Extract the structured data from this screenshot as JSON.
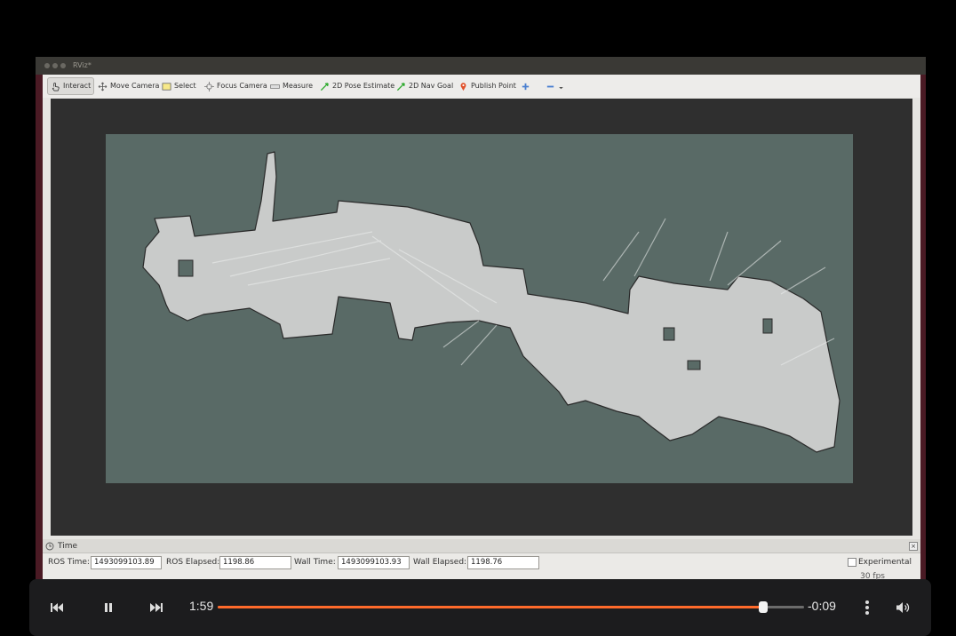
{
  "window": {
    "title": "RViz*"
  },
  "toolbar": {
    "tools": [
      {
        "label": "Interact",
        "icon": "hand-pointer-icon"
      },
      {
        "label": "Move Camera",
        "icon": "move-arrows-icon"
      },
      {
        "label": "Select",
        "icon": "select-box-icon"
      },
      {
        "label": "Focus Camera",
        "icon": "crosshair-icon"
      },
      {
        "label": "Measure",
        "icon": "ruler-icon"
      },
      {
        "label": "2D Pose Estimate",
        "icon": "green-arrow-icon"
      },
      {
        "label": "2D Nav Goal",
        "icon": "green-arrow-icon"
      },
      {
        "label": "Publish Point",
        "icon": "map-pin-icon"
      }
    ]
  },
  "time_panel": {
    "title": "Time",
    "ros_time_label": "ROS Time:",
    "ros_time": "1493099103.89",
    "ros_elapsed_label": "ROS Elapsed:",
    "ros_elapsed": "1198.86",
    "wall_time_label": "Wall Time:",
    "wall_time": "1493099103.93",
    "wall_elapsed_label": "Wall Elapsed:",
    "wall_elapsed": "1198.76",
    "experimental_label": "Experimental",
    "fps": "30 fps"
  },
  "player": {
    "elapsed": "1:59",
    "remaining": "-0:09",
    "progress": 0.93
  },
  "colors": {
    "map_background": "#596a66",
    "free_space": "#c9cbca",
    "progress_accent": "#ff6a2b"
  }
}
